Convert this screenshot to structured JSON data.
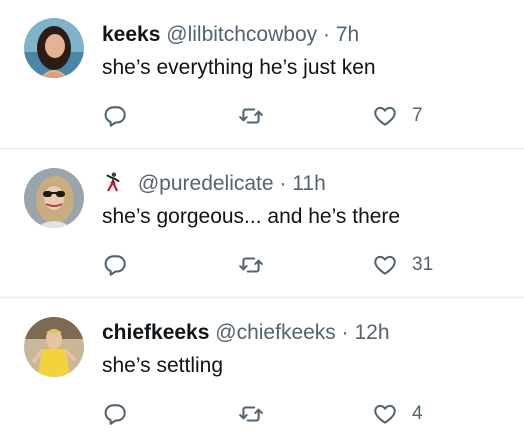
{
  "tweets": [
    {
      "name": "keeks",
      "handle": "@lilbitchcowboy",
      "time": "7h",
      "text": "she’s everything he’s just ken",
      "likes": "7",
      "avatar_icon": "avatar-photo-woman-dark-hair"
    },
    {
      "name": "",
      "name_icon": "dancing-man-emoji",
      "handle": "@puredelicate",
      "time": "11h",
      "text": "she’s gorgeous... and he’s there",
      "likes": "31",
      "avatar_icon": "avatar-photo-woman-sunglasses"
    },
    {
      "name": "chiefkeeks",
      "handle": "@chiefkeeks",
      "time": "12h",
      "text": "she’s settling",
      "likes": "4",
      "avatar_icon": "avatar-photo-person-yellow-shirt"
    }
  ],
  "separator": "·",
  "colors": {
    "text": "#0f1419",
    "secondary": "#536471",
    "divider": "#e6ecf0"
  }
}
